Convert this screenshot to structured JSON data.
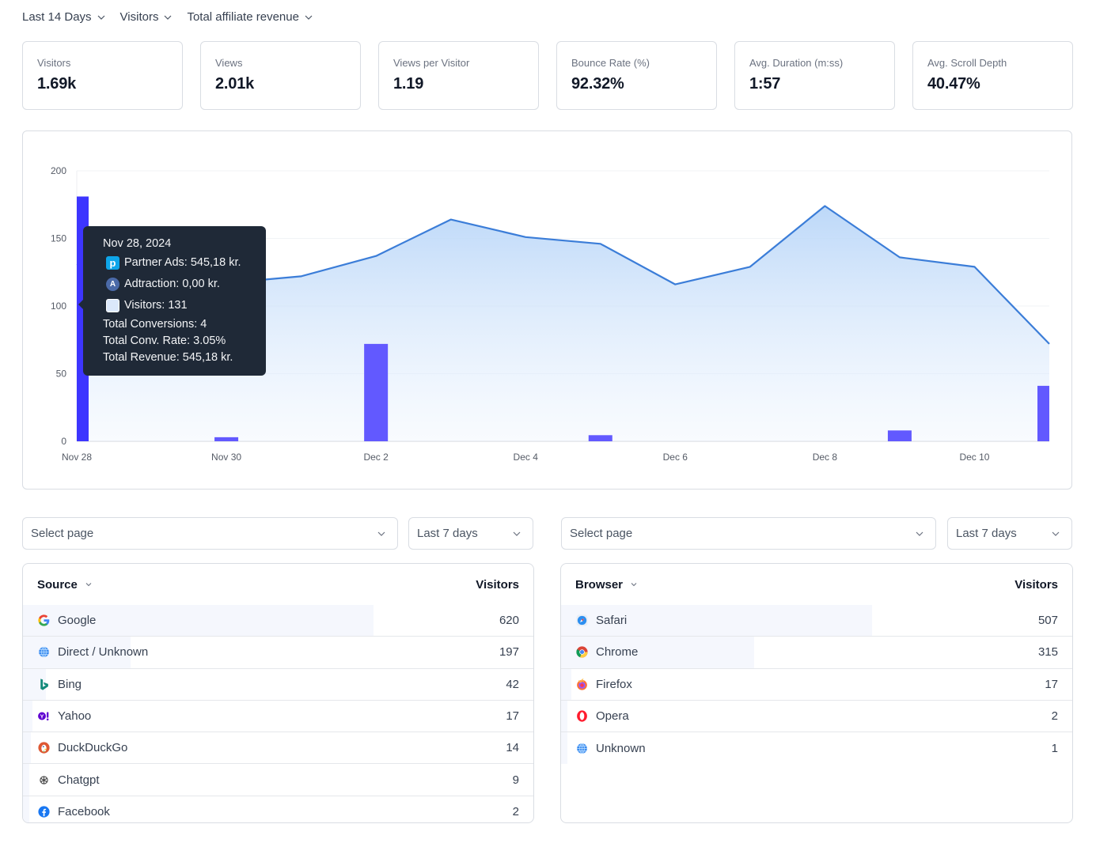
{
  "filters": [
    {
      "label": "Last 14 Days"
    },
    {
      "label": "Visitors"
    },
    {
      "label": "Total affiliate revenue"
    }
  ],
  "stats": [
    {
      "label": "Visitors",
      "value": "1.69k"
    },
    {
      "label": "Views",
      "value": "2.01k"
    },
    {
      "label": "Views per Visitor",
      "value": "1.19"
    },
    {
      "label": "Bounce Rate (%)",
      "value": "92.32%"
    },
    {
      "label": "Avg. Duration (m:ss)",
      "value": "1:57"
    },
    {
      "label": "Avg. Scroll Depth",
      "value": "40.47%"
    }
  ],
  "chart_data": {
    "type": "area",
    "title": "",
    "xlabel": "",
    "ylabel": "",
    "ylim": [
      0,
      200
    ],
    "yticks": [
      0,
      50,
      100,
      150,
      200
    ],
    "grid": true,
    "categories": [
      "Nov 28",
      "Nov 29",
      "Nov 30",
      "Dec 1",
      "Dec 2",
      "Dec 3",
      "Dec 4",
      "Dec 5",
      "Dec 6",
      "Dec 7",
      "Dec 8",
      "Dec 9",
      "Dec 10",
      "Dec 11"
    ],
    "xtick_labels": [
      "Nov 28",
      "Nov 30",
      "Dec 2",
      "Dec 4",
      "Dec 6",
      "Dec 8",
      "Dec 10"
    ],
    "series": [
      {
        "name": "Visitors",
        "type": "area",
        "color": "#3b7dd8",
        "values": [
          131,
          116,
          117,
          122,
          137,
          164,
          151,
          146,
          116,
          129,
          174,
          136,
          129,
          72
        ]
      },
      {
        "name": "Total affiliate revenue",
        "type": "bar",
        "color": "#6259ff",
        "highlight_color": "#3d35ff",
        "values": [
          181,
          0,
          3,
          0,
          72,
          0,
          0,
          4.5,
          0,
          0,
          0,
          8,
          0,
          41
        ]
      }
    ],
    "tooltip": {
      "date": "Nov 28, 2024",
      "rows": [
        {
          "icon": "partner-ads-icon",
          "glyph": "p",
          "text": "Partner Ads: 545,18 kr."
        },
        {
          "icon": "adtraction-icon",
          "glyph": "A",
          "text": "Adtraction: 0,00 kr."
        },
        {
          "icon": "visitors-swatch-icon",
          "glyph": "",
          "text": "Visitors: 131"
        }
      ],
      "totals": [
        "Total Conversions: 4",
        "Total Conv. Rate: 3.05%",
        "Total Revenue: 545,18 kr."
      ]
    }
  },
  "left_controls": {
    "page_placeholder": "Select page",
    "range": "Last 7 days"
  },
  "right_controls": {
    "page_placeholder": "Select page",
    "range": "Last 7 days"
  },
  "sources": {
    "dimension": "Source",
    "metric": "Visitors",
    "rows": [
      {
        "name": "Google",
        "icon": "google-icon",
        "value": 620,
        "share": 0.685
      },
      {
        "name": "Direct / Unknown",
        "icon": "globe-icon",
        "value": 197,
        "share": 0.21
      },
      {
        "name": "Bing",
        "icon": "bing-icon",
        "value": 42,
        "share": 0.045
      },
      {
        "name": "Yahoo",
        "icon": "yahoo-icon",
        "value": 17,
        "share": 0.018
      },
      {
        "name": "DuckDuckGo",
        "icon": "duckduckgo-icon",
        "value": 14,
        "share": 0.015
      },
      {
        "name": "Chatgpt",
        "icon": "chatgpt-icon",
        "value": 9,
        "share": 0.01
      },
      {
        "name": "Facebook",
        "icon": "facebook-icon",
        "value": 2,
        "share": 0.002
      }
    ]
  },
  "browsers": {
    "dimension": "Browser",
    "metric": "Visitors",
    "rows": [
      {
        "name": "Safari",
        "icon": "safari-icon",
        "value": 507,
        "share": 0.606
      },
      {
        "name": "Chrome",
        "icon": "chrome-icon",
        "value": 315,
        "share": 0.376
      },
      {
        "name": "Firefox",
        "icon": "firefox-icon",
        "value": 17,
        "share": 0.02
      },
      {
        "name": "Opera",
        "icon": "opera-icon",
        "value": 2,
        "share": 0.003
      },
      {
        "name": "Unknown",
        "icon": "globe-icon",
        "value": 1,
        "share": 0.001
      }
    ]
  }
}
